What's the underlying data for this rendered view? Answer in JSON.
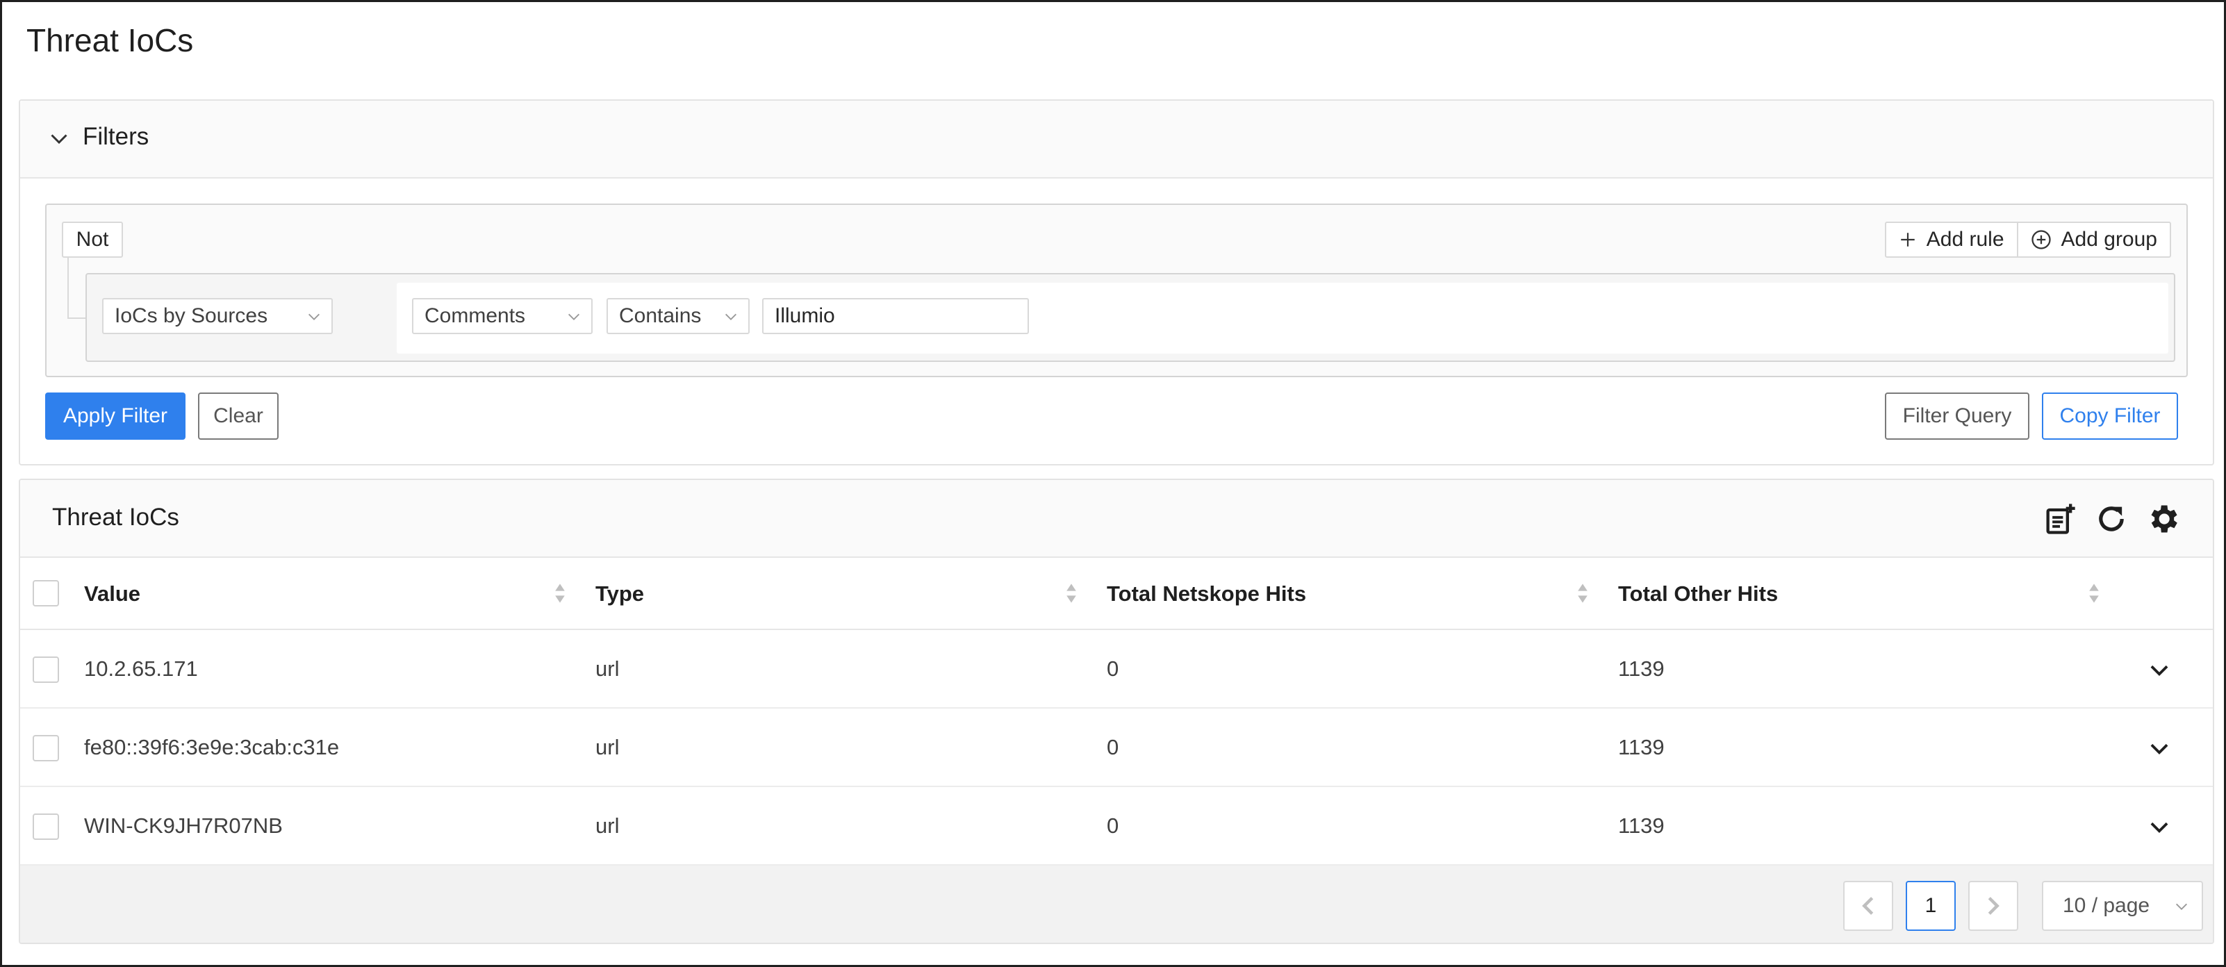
{
  "page": {
    "title": "Threat IoCs"
  },
  "filters": {
    "title": "Filters",
    "not_label": "Not",
    "add_rule_label": "Add rule",
    "add_group_label": "Add group",
    "source_select": "IoCs by Sources",
    "rule": {
      "field": "Comments",
      "operator": "Contains",
      "value": "Illumio"
    },
    "apply_label": "Apply Filter",
    "clear_label": "Clear",
    "filter_query_label": "Filter Query",
    "copy_filter_label": "Copy Filter"
  },
  "table": {
    "title": "Threat IoCs",
    "toolbar_icons": [
      "add-note-icon",
      "refresh-icon",
      "settings-gear-icon"
    ],
    "columns": [
      "Value",
      "Type",
      "Total Netskope Hits",
      "Total Other Hits"
    ],
    "rows": [
      {
        "value": "10.2.65.171",
        "type": "url",
        "netskope_hits": "0",
        "other_hits": "1139"
      },
      {
        "value": "fe80::39f6:3e9e:3cab:c31e",
        "type": "url",
        "netskope_hits": "0",
        "other_hits": "1139"
      },
      {
        "value": "WIN-CK9JH7R07NB",
        "type": "url",
        "netskope_hits": "0",
        "other_hits": "1139"
      }
    ]
  },
  "pagination": {
    "current_page": "1",
    "page_size": "10 / page"
  },
  "colors": {
    "primary": "#2f80ed",
    "border": "#d9d9d9",
    "header_bg": "#fafafa"
  }
}
